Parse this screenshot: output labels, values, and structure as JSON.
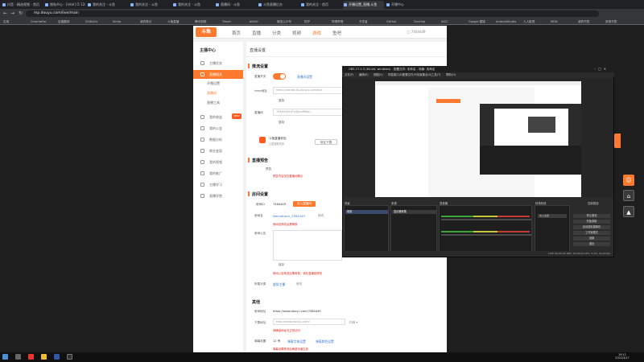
{
  "browser": {
    "tabs": [
      "抖音 - 精选视频 - 首页",
      "隐私中心 - [intel] i5 12400F",
      "我的关注 - 斗鱼",
      "我的关注 - 斗鱼",
      "我的关注 - 斗鱼",
      "直播间 - 斗鱼",
      "斗鱼直播后台",
      "我的关注 - 首页",
      "开播设置_直播,斗鱼",
      "开播中心"
    ],
    "url": "mp.douyu.com/live/main",
    "bookmarks": [
      "应用",
      "ChromeFor",
      "百度翻译",
      "ZhiKuDu",
      "Kimia",
      "我的笔记",
      "斗鱼直播",
      "腾讯视频",
      "Trover",
      "bilibili",
      "微信公众号",
      "知乎",
      "哔哩哔哩",
      "开发者",
      "GitHub",
      "ZanHub",
      "AIGC",
      "Google 翻译",
      "AndroidStudio",
      "人人影视",
      "MDN",
      "我的书签",
      "其他书签"
    ]
  },
  "site": {
    "logo_text": "斗鱼",
    "nav": [
      "首页",
      "直播",
      "分类",
      "视频",
      "游戏",
      "鱼吧"
    ],
    "sidebar_title": "主播中心",
    "sidebar": [
      "主播任务",
      "直播相关",
      "开播设置",
      "直播间",
      "直播工具",
      "我的收益",
      "我的公会",
      "数据分析",
      "商业变现",
      "我的视频",
      "我的推广",
      "主播学习",
      "直播学院"
    ],
    "page_heading": "直播设置",
    "sec_push": "推流设置",
    "live_switch": "直播开关",
    "rtmp_label": "rtmp地址",
    "rtmp_value": "rtmp://sendtc3a.douyu.com/live",
    "key_label": "直播码",
    "key_value": "7464449rXTz@pU6R6p...",
    "copy": "复制",
    "tool_title": "斗鱼直播伴侣",
    "tool_sub": "让直播更简单",
    "tool_btn": "前往下载",
    "sec_preview": "直播预告",
    "preview_label": "预告",
    "sec_room": "房间设置",
    "room_id_label": "房间ID",
    "room_id": "7464449",
    "room_name_label": "房间名",
    "notice_label": "房间公告",
    "category_label": "所属分类",
    "other": "其他",
    "room_addr_label": "房间地址",
    "room_addr": "https://www.douyu.com/7464449",
    "stream_addr_label": "下载地址",
    "save": "保存"
  },
  "obs": {
    "title": "OBS 27.2.3 (64-bit, windows) - 配置文件: 未命名 - 场景: 未命名",
    "menu": [
      "文件(F)",
      "编辑(E)",
      "视图(V)",
      "停靠窗口(D)",
      "配置文件(P)",
      "场景集合(S)",
      "工具(T)",
      "帮助(H)"
    ],
    "scenes": "场景",
    "sources": "来源",
    "mixer": "混音器",
    "transitions": "转场特效",
    "controls": "控制按钮",
    "buttons": [
      "停止推流",
      "开始录制",
      "启动虚拟摄像机",
      "工作室模式",
      "设置",
      "退出"
    ],
    "status": "LIVE: 00:00:00   REC: 00:00:00   CPU: 3.2%, 30.00 fps"
  },
  "taskbar": {
    "time": "19:11",
    "date": "2022/3/17"
  }
}
